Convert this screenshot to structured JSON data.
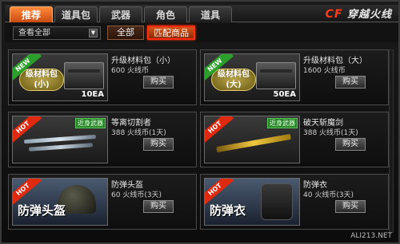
{
  "tabs": [
    {
      "label": "推荐",
      "active": true
    },
    {
      "label": "道具包",
      "active": false
    },
    {
      "label": "武器",
      "active": false
    },
    {
      "label": "角色",
      "active": false
    },
    {
      "label": "道具",
      "active": false
    }
  ],
  "logo": {
    "cf": "CF",
    "text": "穿越火线"
  },
  "filter": {
    "dropdown_value": "查看全部",
    "all_label": "全部",
    "match_label": "匹配商品"
  },
  "items": [
    {
      "name": "升级材料包（小）",
      "price": "600 火线币",
      "buy": "购买",
      "badge": "NEW",
      "pkg_label": "级材料包(小)",
      "qty": "10EA"
    },
    {
      "name": "升级材料包（大）",
      "price": "1600 火线币",
      "buy": "购买",
      "badge": "NEW",
      "pkg_label": "级材料包(大)",
      "qty": "50EA"
    },
    {
      "name": "等离切割者",
      "price": "388 火线币(1天)",
      "buy": "购买",
      "badge": "HOT",
      "tag": "近身武器"
    },
    {
      "name": "破天斩魔剑",
      "price": "388 火线币(1天)",
      "buy": "购买",
      "badge": "HOT",
      "tag": "近身武器"
    },
    {
      "name": "防弹头盔",
      "price": "60 火线币(3天)",
      "buy": "购买",
      "badge": "HOT",
      "big_label": "防弹头盔"
    },
    {
      "name": "防弹衣",
      "price": "40 火线币(3天)",
      "buy": "购买",
      "badge": "HOT",
      "big_label": "防弹衣"
    }
  ],
  "watermark": "ALI213.NET"
}
